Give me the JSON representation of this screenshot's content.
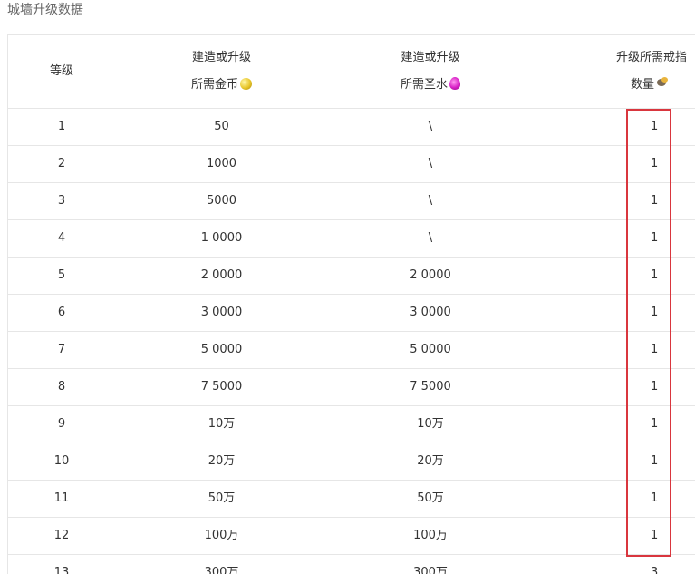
{
  "page": {
    "title": "城墙升级数据"
  },
  "table": {
    "headers": {
      "level": "等级",
      "gold_line1": "建造或升级",
      "gold_line2": "所需金币",
      "elixir_line1": "建造或升级",
      "elixir_line2": "所需圣水",
      "ring_line1": "升级所需戒指",
      "ring_line2": "数量"
    },
    "icons": {
      "gold": "gold-coin-icon",
      "elixir": "elixir-drop-icon",
      "ring": "wall-ring-icon"
    },
    "rows": [
      {
        "level": "1",
        "gold": "50",
        "elixir": "\\",
        "rings": "1"
      },
      {
        "level": "2",
        "gold": "1000",
        "elixir": "\\",
        "rings": "1"
      },
      {
        "level": "3",
        "gold": "5000",
        "elixir": "\\",
        "rings": "1"
      },
      {
        "level": "4",
        "gold": "1 0000",
        "elixir": "\\",
        "rings": "1"
      },
      {
        "level": "5",
        "gold": "2 0000",
        "elixir": "2 0000",
        "rings": "1"
      },
      {
        "level": "6",
        "gold": "3 0000",
        "elixir": "3 0000",
        "rings": "1"
      },
      {
        "level": "7",
        "gold": "5 0000",
        "elixir": "5 0000",
        "rings": "1"
      },
      {
        "level": "8",
        "gold": "7 5000",
        "elixir": "7 5000",
        "rings": "1"
      },
      {
        "level": "9",
        "gold": "10万",
        "elixir": "10万",
        "rings": "1"
      },
      {
        "level": "10",
        "gold": "20万",
        "elixir": "20万",
        "rings": "1"
      },
      {
        "level": "11",
        "gold": "50万",
        "elixir": "50万",
        "rings": "1"
      },
      {
        "level": "12",
        "gold": "100万",
        "elixir": "100万",
        "rings": "1"
      },
      {
        "level": "13",
        "gold": "300万",
        "elixir": "300万",
        "rings": "3"
      }
    ]
  },
  "colors": {
    "highlight": "#d9363e",
    "border": "#e6e6e6",
    "text": "#333333"
  }
}
